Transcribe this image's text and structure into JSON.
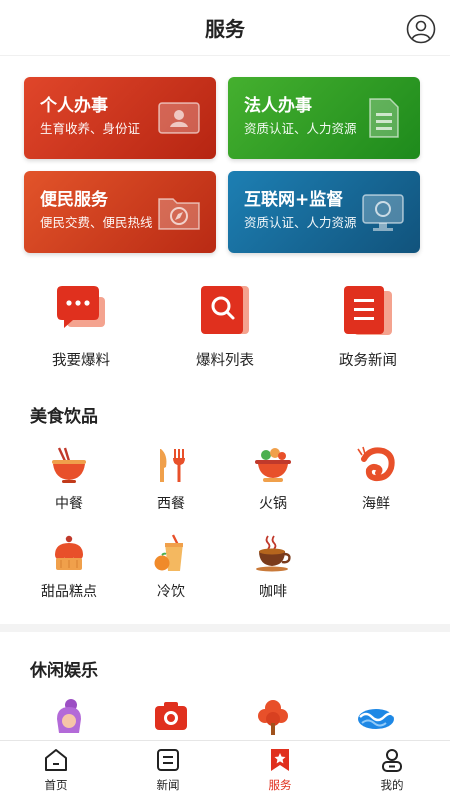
{
  "header": {
    "title": "服务"
  },
  "cards": [
    {
      "title": "个人办事",
      "subtitle": "生育收养、身份证"
    },
    {
      "title": "法人办事",
      "subtitle": "资质认证、人力资源"
    },
    {
      "title": "便民服务",
      "subtitle": "便民交费、便民热线"
    },
    {
      "title": "互联网+监督",
      "subtitle": "资质认证、人力资源"
    }
  ],
  "quick": [
    {
      "label": "我要爆料",
      "icon": "chat-bubble-icon"
    },
    {
      "label": "爆料列表",
      "icon": "search-list-icon"
    },
    {
      "label": "政务新闻",
      "icon": "news-doc-icon"
    }
  ],
  "food": {
    "title": "美食饮品",
    "items": [
      {
        "label": "中餐",
        "icon": "noodle-bowl-icon"
      },
      {
        "label": "西餐",
        "icon": "knife-fork-icon"
      },
      {
        "label": "火锅",
        "icon": "hotpot-icon"
      },
      {
        "label": "海鲜",
        "icon": "shrimp-icon"
      },
      {
        "label": "甜品糕点",
        "icon": "cake-icon"
      },
      {
        "label": "冷饮",
        "icon": "cold-drink-icon"
      },
      {
        "label": "咖啡",
        "icon": "coffee-cup-icon"
      }
    ]
  },
  "leisure": {
    "title": "休闲娱乐",
    "items": [
      {
        "icon": "hair-salon-icon"
      },
      {
        "icon": "camera-icon"
      },
      {
        "icon": "tree-park-icon"
      },
      {
        "icon": "water-wave-icon"
      }
    ]
  },
  "tabbar": {
    "items": [
      {
        "label": "首页",
        "icon": "home-icon"
      },
      {
        "label": "新闻",
        "icon": "news-icon"
      },
      {
        "label": "服务",
        "icon": "service-icon",
        "active": true
      },
      {
        "label": "我的",
        "icon": "profile-icon"
      }
    ]
  },
  "colors": {
    "accent": "#e0301e",
    "green": "#3aa62b",
    "blue": "#1a6f9f"
  }
}
